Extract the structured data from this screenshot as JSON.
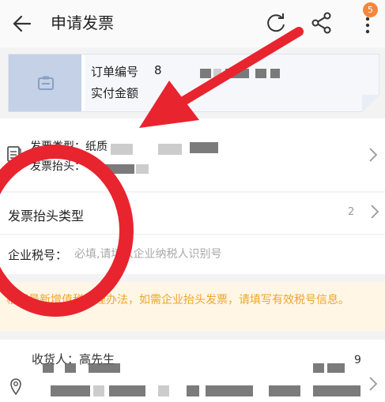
{
  "header": {
    "title": "申请发票",
    "notification_count": "5",
    "icons": [
      "back-arrow-icon",
      "refresh-icon",
      "share-icon",
      "more-icon"
    ]
  },
  "order_card": {
    "order_number_label": "订单编号",
    "order_number_prefix": "8",
    "amount_label": "实付金额"
  },
  "invoice_info": {
    "type_label": "发票类型：纸质",
    "header_label": "发票抬头："
  },
  "form": {
    "header_type_label": "发票抬头类型",
    "header_type_value": "2",
    "tax_label": "企业税号：",
    "tax_placeholder": "必填,请填入企业纳税人识别号"
  },
  "notice": {
    "text": "根据最新增值税管理办法，如需企业抬头发票，请填写有效税号信息。"
  },
  "receiver": {
    "label": "收货人：高先生",
    "phone": "9"
  },
  "colors": {
    "annotation": "#e8242f",
    "notice_text": "#f0a52a",
    "notice_bg": "#fff6e6",
    "badge": "#f5873c"
  }
}
